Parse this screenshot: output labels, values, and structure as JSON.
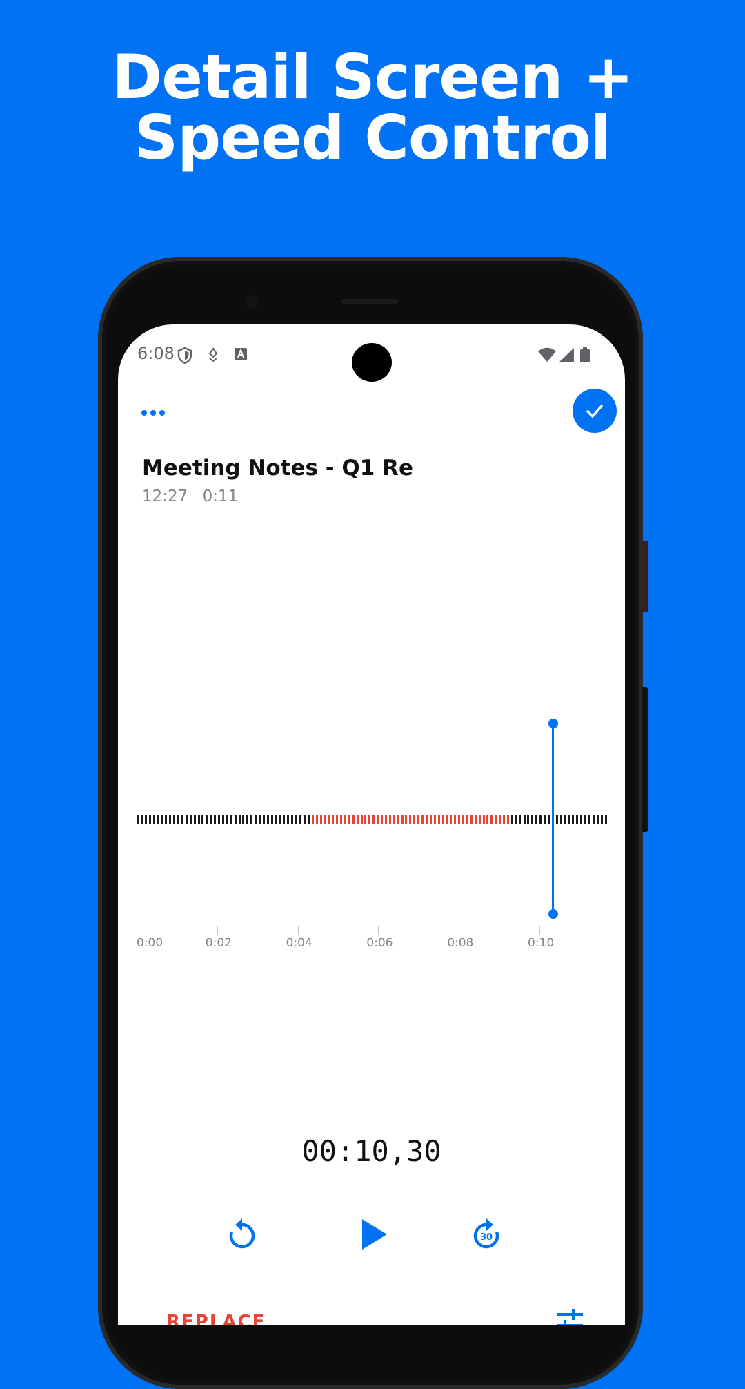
{
  "promo": {
    "title_line1": "Detail Screen +",
    "title_line2": "Speed Control"
  },
  "status_bar": {
    "time": "6:08",
    "icons": [
      "shield-icon",
      "location-icon",
      "text-icon",
      "wifi-icon",
      "signal-icon",
      "battery-icon"
    ]
  },
  "toolbar": {
    "more_icon": "more-horizontal-icon",
    "done_icon": "check-icon"
  },
  "recording": {
    "title": "Meeting Notes - Q1 Re",
    "time": "12:27",
    "duration": "0:11"
  },
  "timeline": {
    "ticks": [
      "0:00",
      "0:02",
      "0:04",
      "0:06",
      "0:08",
      "0:10"
    ],
    "total_seconds": 11,
    "selection_start_seconds": 4.3,
    "selection_end_seconds": 9.2,
    "playhead_seconds": 10.3
  },
  "player": {
    "timer": "00:10,30",
    "rewind_icon": "rewind-icon",
    "play_icon": "play-icon",
    "forward_label": "30",
    "forward_icon": "forward-30-icon"
  },
  "bottom_bar": {
    "replace_label": "REPLACE",
    "settings_icon": "tune-icon"
  },
  "colors": {
    "brand": "#0272f5",
    "selection": "#ea4335",
    "wave": "#1b1b1b"
  }
}
